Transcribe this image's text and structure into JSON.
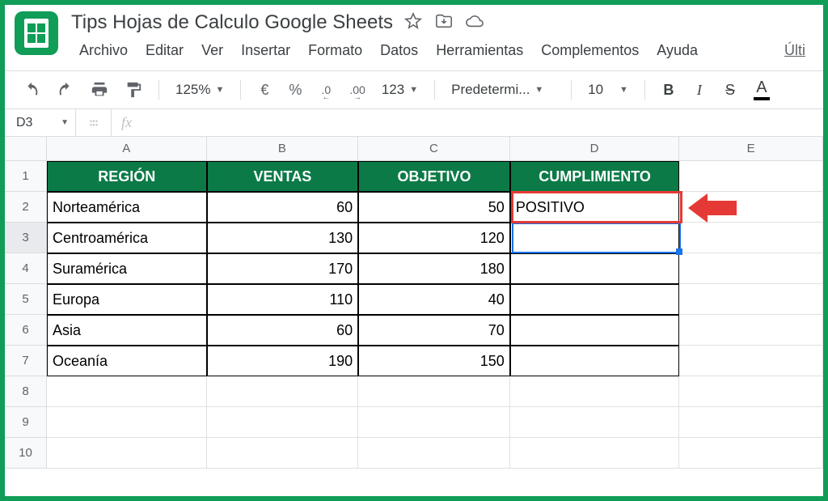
{
  "header": {
    "title": "Tips Hojas de Calculo Google Sheets",
    "menus": [
      "Archivo",
      "Editar",
      "Ver",
      "Insertar",
      "Formato",
      "Datos",
      "Herramientas",
      "Complementos",
      "Ayuda"
    ],
    "lastEdit": "Últi"
  },
  "toolbar": {
    "zoom": "125%",
    "currency": "€",
    "percent": "%",
    "dec_less": ".0",
    "dec_more": ".00",
    "more_fmt": "123",
    "font": "Predetermi...",
    "font_size": "10",
    "bold": "B",
    "italic": "I",
    "strike": "S",
    "text_color": "A"
  },
  "fx": {
    "cell_ref": "D3",
    "fx_label": "fx",
    "formula": ""
  },
  "columns": [
    "A",
    "B",
    "C",
    "D",
    "E"
  ],
  "row_numbers": [
    "1",
    "2",
    "3",
    "4",
    "5",
    "6",
    "7",
    "8",
    "9",
    "10"
  ],
  "table": {
    "headers": {
      "A": "REGIÓN",
      "B": "VENTAS",
      "C": "OBJETIVO",
      "D": "CUMPLIMIENTO"
    },
    "rows": [
      {
        "A": "Norteamérica",
        "B": "60",
        "C": "50",
        "D": "POSITIVO"
      },
      {
        "A": "Centroamérica",
        "B": "130",
        "C": "120",
        "D": ""
      },
      {
        "A": "Suramérica",
        "B": "170",
        "C": "180",
        "D": ""
      },
      {
        "A": "Europa",
        "B": "110",
        "C": "40",
        "D": ""
      },
      {
        "A": "Asia",
        "B": "60",
        "C": "70",
        "D": ""
      },
      {
        "A": "Oceanía",
        "B": "190",
        "C": "150",
        "D": ""
      }
    ]
  },
  "colors": {
    "header_bg": "#0b7a47",
    "selection": "#1a73e8",
    "highlight_box": "#e53935"
  }
}
